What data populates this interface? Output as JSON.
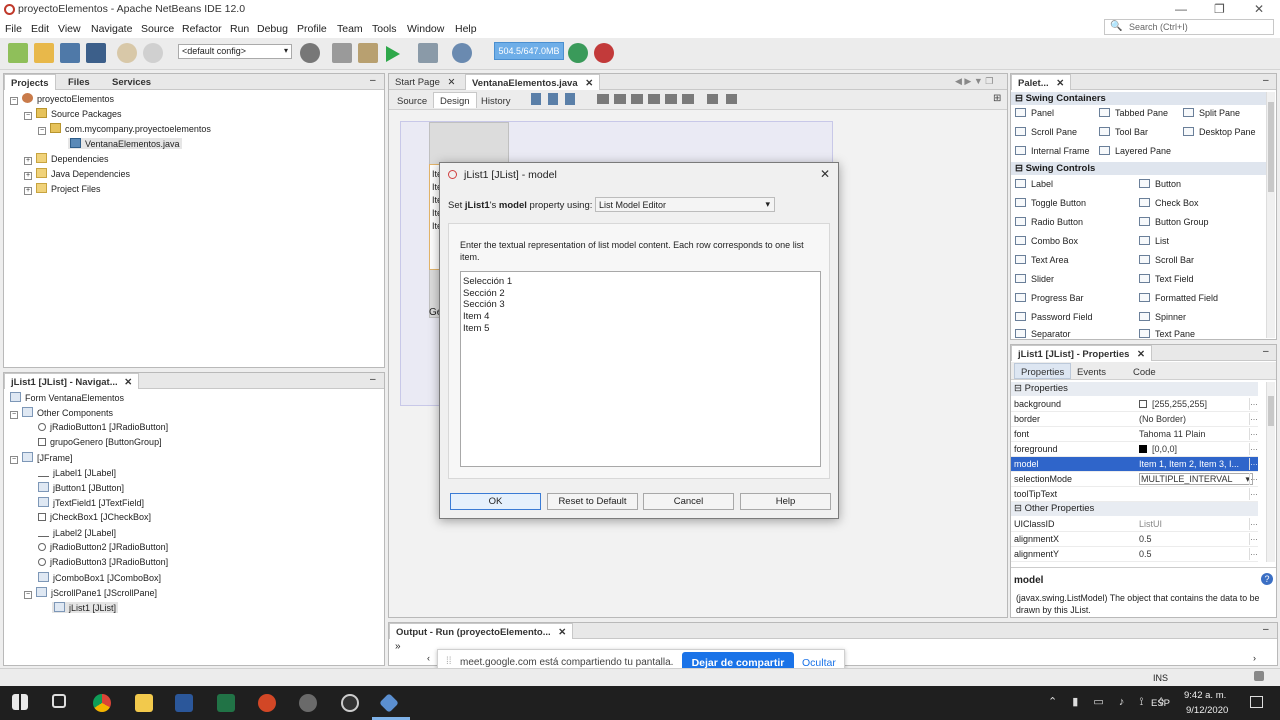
{
  "window": {
    "title": "proyectoElementos - Apache NetBeans IDE 12.0"
  },
  "menu": [
    "File",
    "Edit",
    "View",
    "Navigate",
    "Source",
    "Refactor",
    "Run",
    "Debug",
    "Profile",
    "Team",
    "Tools",
    "Window",
    "Help"
  ],
  "search": {
    "placeholder": "Search (Ctrl+I)"
  },
  "toolbar": {
    "config": "<default config>",
    "memory": "504.5/647.0MB"
  },
  "projects_panel": {
    "tabs": [
      "Projects",
      "Files",
      "Services"
    ],
    "tree": [
      {
        "label": "proyectoElementos",
        "icon": "project-icon"
      },
      {
        "label": "Source Packages",
        "icon": "package-folder-icon"
      },
      {
        "label": "com.mycompany.proyectoelementos",
        "icon": "package-icon"
      },
      {
        "label": "VentanaElementos.java",
        "icon": "java-file-icon"
      },
      {
        "label": "Dependencies",
        "icon": "folder-icon"
      },
      {
        "label": "Java Dependencies",
        "icon": "folder-icon"
      },
      {
        "label": "Project Files",
        "icon": "folder-icon"
      }
    ]
  },
  "navigator": {
    "title": "jList1 [JList] - Navigat...",
    "tree": [
      "Form VentanaElementos",
      "Other Components",
      "jRadioButton1 [JRadioButton]",
      "grupoGenero [ButtonGroup]",
      "[JFrame]",
      "jLabel1 [JLabel]",
      "jButton1 [JButton]",
      "jTextField1 [JTextField]",
      "jCheckBox1 [JCheckBox]",
      "jLabel2 [JLabel]",
      "jRadioButton2 [JRadioButton]",
      "jRadioButton3 [JRadioButton]",
      "jComboBox1 [JComboBox]",
      "jScrollPane1 [JScrollPane]",
      "jList1 [JList]"
    ]
  },
  "editor": {
    "tabs": [
      "Start Page",
      "VentanaElementos.java"
    ],
    "subtabs": [
      "Source",
      "Design",
      "History"
    ],
    "form_list_items": [
      "Ite",
      "Ite",
      "Ite",
      "Ite",
      "Ite"
    ],
    "form_label": "Ge"
  },
  "dialog": {
    "title": "jList1 [JList] - model",
    "set_prefix": "Set ",
    "set_bold_name": "jList1",
    "set_middle": "'s ",
    "set_bold_prop": "model",
    "set_suffix": " property using:",
    "editor_select": "List Model Editor",
    "instructions": "Enter the textual representation of list model content. Each row corresponds to one list item.",
    "items": [
      "Selección 1",
      "Sección 2",
      "Sección 3",
      "Item 4",
      "Item 5"
    ],
    "buttons": {
      "ok": "OK",
      "reset": "Reset to Default",
      "cancel": "Cancel",
      "help": "Help"
    }
  },
  "palette": {
    "title": "Palet...",
    "categories": [
      {
        "name": "Swing Containers",
        "items": [
          "Panel",
          "Tabbed Pane",
          "Split Pane",
          "Scroll Pane",
          "Tool Bar",
          "Desktop Pane",
          "Internal Frame",
          "Layered Pane"
        ]
      },
      {
        "name": "Swing Controls",
        "items": [
          "Label",
          "Button",
          "Toggle Button",
          "Check Box",
          "Radio Button",
          "Button Group",
          "Combo Box",
          "List",
          "Text Area",
          "Scroll Bar",
          "Slider",
          "Text Field",
          "Progress Bar",
          "Formatted Field",
          "Password Field",
          "Spinner",
          "Separator",
          "Text Pane"
        ]
      }
    ]
  },
  "properties": {
    "title": "jList1 [JList] - Properties",
    "tabs": [
      "Properties",
      "Events",
      "Code"
    ],
    "cat1": "Properties",
    "rows": [
      {
        "name": "background",
        "value": "[255,255,255]"
      },
      {
        "name": "border",
        "value": "(No Border)"
      },
      {
        "name": "font",
        "value": "Tahoma 11 Plain"
      },
      {
        "name": "foreground",
        "value": "[0,0,0]"
      },
      {
        "name": "model",
        "value": "Item 1, Item 2, Item 3, I..."
      },
      {
        "name": "selectionMode",
        "value": "MULTIPLE_INTERVAL"
      },
      {
        "name": "toolTipText",
        "value": ""
      }
    ],
    "cat2": "Other Properties",
    "rows2": [
      {
        "name": "UIClassID",
        "value": "ListUI"
      },
      {
        "name": "alignmentX",
        "value": "0.5"
      },
      {
        "name": "alignmentY",
        "value": "0.5"
      }
    ],
    "help_title": "model",
    "help_text": "(javax.swing.ListModel) The object that contains the data to be drawn by this JList."
  },
  "output": {
    "title": "Output - Run (proyectoElemento..."
  },
  "share_bar": {
    "text": "meet.google.com está compartiendo tu pantalla.",
    "stop": "Dejar de compartir",
    "hide": "Ocultar"
  },
  "status": {
    "ins": "INS"
  },
  "taskbar": {
    "lang": "ESP",
    "time": "9:42 a. m.",
    "date": "9/12/2020"
  },
  "colors": {
    "selection": "#2f65ca",
    "accent": "#1a73e8",
    "memory": "#6eaee8"
  }
}
